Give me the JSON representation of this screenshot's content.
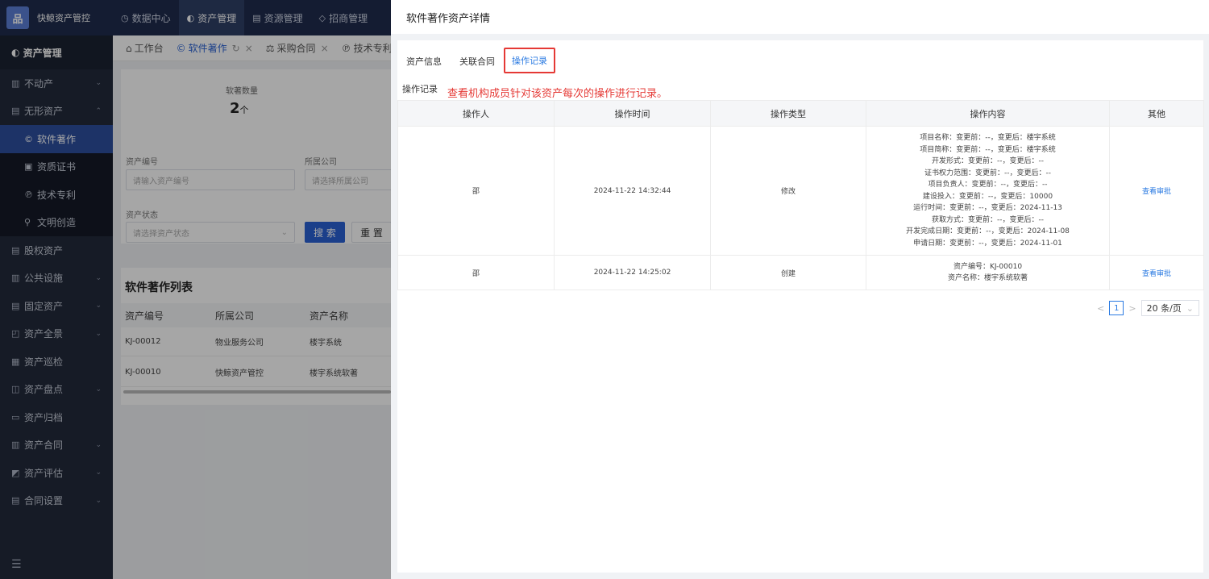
{
  "app": {
    "logo_glyph": "品",
    "logo_text": "快鲸资产管控"
  },
  "topnav": [
    {
      "icon": "clock-icon",
      "glyph": "◷",
      "label": "数据中心"
    },
    {
      "icon": "cube-icon",
      "glyph": "◐",
      "label": "资产管理"
    },
    {
      "icon": "doc-icon",
      "glyph": "▤",
      "label": "资源管理"
    },
    {
      "icon": "tag-icon",
      "glyph": "◇",
      "label": "招商管理"
    }
  ],
  "sidebar": {
    "head": "资产管理",
    "items": [
      {
        "label": "不动产",
        "glyph": "▥",
        "arrow": "⌄"
      },
      {
        "label": "无形资产",
        "glyph": "▤",
        "arrow": "⌃"
      }
    ],
    "subs": [
      {
        "label": "软件著作",
        "glyph": "©"
      },
      {
        "label": "资质证书",
        "glyph": "▣"
      },
      {
        "label": "技术专利",
        "glyph": "℗"
      },
      {
        "label": "文明创造",
        "glyph": "⚲"
      }
    ],
    "items2": [
      {
        "label": "股权资产",
        "glyph": "▤",
        "arrow": ""
      },
      {
        "label": "公共设施",
        "glyph": "▥",
        "arrow": "⌄"
      },
      {
        "label": "固定资产",
        "glyph": "▤",
        "arrow": "⌄"
      },
      {
        "label": "资产全景",
        "glyph": "◰",
        "arrow": "⌄"
      },
      {
        "label": "资产巡检",
        "glyph": "▦",
        "arrow": ""
      },
      {
        "label": "资产盘点",
        "glyph": "◫",
        "arrow": "⌄"
      },
      {
        "label": "资产归档",
        "glyph": "▭",
        "arrow": ""
      },
      {
        "label": "资产合同",
        "glyph": "▥",
        "arrow": "⌄"
      },
      {
        "label": "资产评估",
        "glyph": "◩",
        "arrow": "⌄"
      },
      {
        "label": "合同设置",
        "glyph": "▤",
        "arrow": "⌄"
      }
    ],
    "collapse_glyph": "☰"
  },
  "main": {
    "tabs": [
      {
        "glyph": "⌂",
        "label": "工作台",
        "active": false
      },
      {
        "glyph": "©",
        "label": "软件著作",
        "active": true
      },
      {
        "glyph": "⚖",
        "label": "采购合同",
        "active": false
      },
      {
        "glyph": "℗",
        "label": "技术专利",
        "active": false
      }
    ],
    "stat_label": "软著数量",
    "stat_value": "2",
    "stat_unit": "个",
    "filter": {
      "code_label": "资产编号",
      "code_placeholder": "请输入资产编号",
      "company_label": "所属公司",
      "company_placeholder": "请选择所属公司",
      "status_label": "资产状态",
      "status_placeholder": "请选择资产状态",
      "search": "搜 索",
      "reset": "重 置"
    },
    "list": {
      "title": "软件著作列表",
      "headers": [
        "资产编号",
        "所属公司",
        "资产名称"
      ],
      "rows": [
        [
          "KJ-00012",
          "物业服务公司",
          "楼宇系统"
        ],
        [
          "KJ-00010",
          "快鲸资产管控",
          "楼宇系统软著"
        ]
      ]
    }
  },
  "drawer": {
    "title": "软件著作资产详情",
    "tabs": [
      "资产信息",
      "关联合同",
      "操作记录"
    ],
    "section_title": "操作记录",
    "section_note": "查看机构成员针对该资产每次的操作进行记录。",
    "table_headers": [
      "操作人",
      "操作时间",
      "操作类型",
      "操作内容",
      "其他"
    ],
    "rows": [
      {
        "operator": "邵",
        "time": "2024-11-22 14:32:44",
        "type": "修改",
        "lines": [
          "项目名称：变更前：--，变更后：楼宇系统",
          "项目简称：变更前：--，变更后：楼宇系统",
          "开发形式：变更前：--，变更后：--",
          "证书权力范围：变更前：--，变更后：--",
          "项目负责人：变更前：--，变更后：--",
          "建设投入：变更前：--，变更后：10000",
          "运行时间：变更前：--，变更后：2024-11-13",
          "获取方式：变更前：--，变更后：--",
          "开发完成日期：变更前：--，变更后：2024-11-08",
          "申请日期：变更前：--，变更后：2024-11-01"
        ],
        "action": "查看审批"
      },
      {
        "operator": "邵",
        "time": "2024-11-22 14:25:02",
        "type": "创建",
        "lines": [
          "资产编号：KJ-00010",
          "资产名称：楼宇系统软著"
        ],
        "action": "查看审批"
      }
    ],
    "pager": {
      "prev": "<",
      "page": "1",
      "next": ">",
      "size": "20 条/页",
      "size_arrow": "⌄"
    }
  }
}
